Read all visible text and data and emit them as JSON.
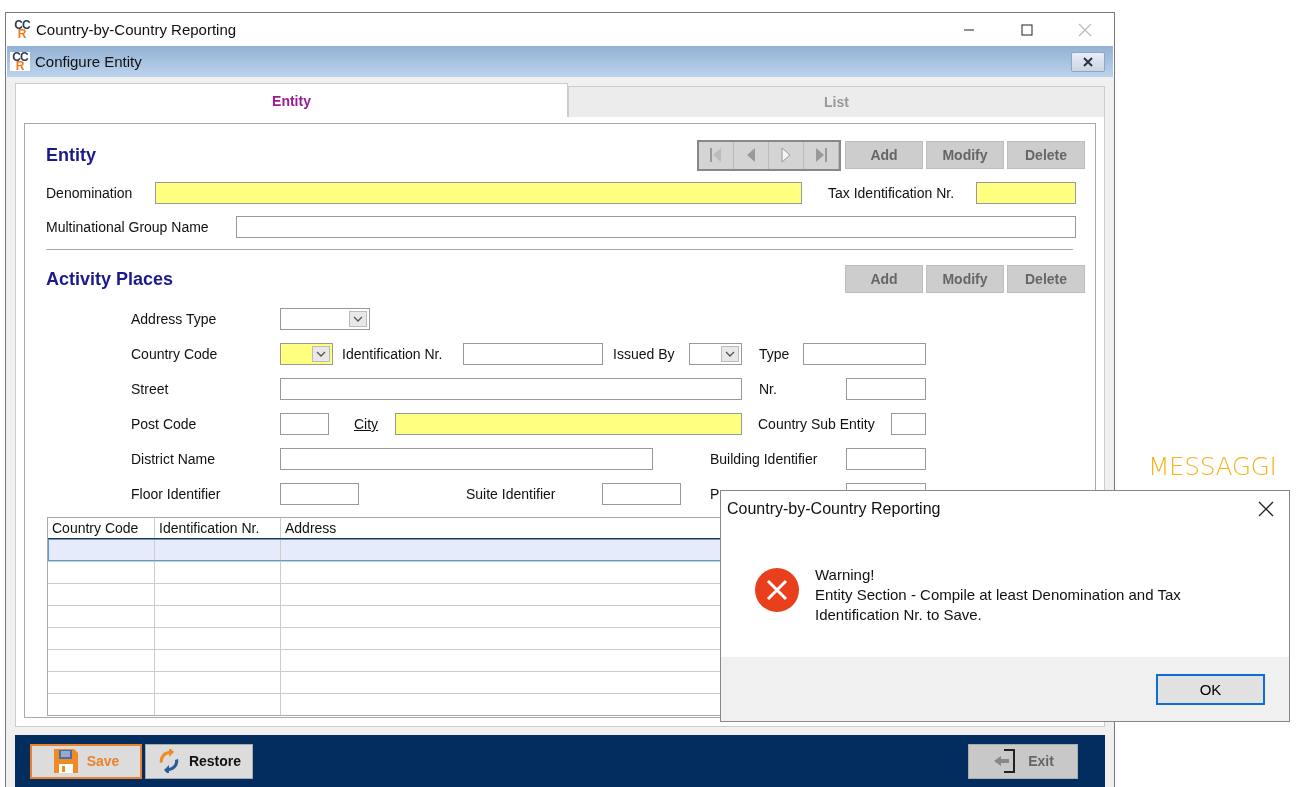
{
  "window": {
    "title": "Country-by-Country Reporting",
    "icon": {
      "top": "CC",
      "bottom": "R"
    },
    "close_disabled": true
  },
  "inner_window": {
    "title": "Configure Entity",
    "icon": {
      "top": "CC",
      "bottom": "R"
    }
  },
  "tabs": [
    {
      "label": "Entity",
      "selected": true
    },
    {
      "label": "List",
      "selected": false
    }
  ],
  "entity": {
    "heading": "Entity",
    "navigator_disabled": true,
    "buttons": [
      {
        "label": "Add",
        "disabled": true
      },
      {
        "label": "Modify",
        "disabled": true
      },
      {
        "label": "Delete",
        "disabled": true
      }
    ],
    "denomination": {
      "label": "Denomination",
      "required": true
    },
    "tax_id": {
      "label": "Tax Identification Nr.",
      "required": true
    },
    "group_name": {
      "label": "Multinational Group Name",
      "required": false
    }
  },
  "activity_places": {
    "heading": "Activity Places",
    "buttons": [
      {
        "label": "Add",
        "disabled": true
      },
      {
        "label": "Modify",
        "disabled": true
      },
      {
        "label": "Delete",
        "disabled": true
      }
    ],
    "fields": [
      {
        "kind": "label",
        "text": "Address Type"
      },
      {
        "kind": "combo",
        "required": false
      },
      {
        "kind": "label",
        "text": "Country Code"
      },
      {
        "kind": "combo",
        "required": true
      },
      {
        "kind": "label",
        "text": "Identification Nr."
      },
      {
        "kind": "field",
        "required": false
      },
      {
        "kind": "label",
        "text": "Issued By"
      },
      {
        "kind": "combo",
        "required": false
      },
      {
        "kind": "label",
        "text": "Type"
      },
      {
        "kind": "field",
        "required": false
      },
      {
        "kind": "label",
        "text": "Street"
      },
      {
        "kind": "field",
        "required": false
      },
      {
        "kind": "label",
        "text": "Nr."
      },
      {
        "kind": "field",
        "required": false
      },
      {
        "kind": "label",
        "text": "Post Code"
      },
      {
        "kind": "field",
        "required": false
      },
      {
        "kind": "link",
        "text": "City"
      },
      {
        "kind": "field",
        "required": true
      },
      {
        "kind": "label",
        "text": "Country Sub Entity"
      },
      {
        "kind": "field",
        "required": false
      },
      {
        "kind": "label",
        "text": "District Name"
      },
      {
        "kind": "field",
        "required": false
      },
      {
        "kind": "label",
        "text": "Building Identifier"
      },
      {
        "kind": "field",
        "required": false
      },
      {
        "kind": "label",
        "text": "Floor Identifier"
      },
      {
        "kind": "field",
        "required": false
      },
      {
        "kind": "label",
        "text": "Suite Identifier"
      },
      {
        "kind": "field",
        "required": false
      },
      {
        "kind": "label",
        "text": "P"
      },
      {
        "kind": "field",
        "required": false
      }
    ]
  },
  "table": {
    "columns": [
      "Country Code",
      "Identification Nr.",
      "Address"
    ],
    "rows": [
      {
        "selected": true
      },
      {
        "selected": false
      },
      {
        "selected": false
      },
      {
        "selected": false
      },
      {
        "selected": false
      },
      {
        "selected": false
      },
      {
        "selected": false
      },
      {
        "selected": false
      }
    ]
  },
  "footer": {
    "buttons": [
      {
        "kind": "save",
        "label": "Save",
        "focused": true,
        "disabled": false
      },
      {
        "kind": "restore",
        "label": "Restore",
        "focused": false,
        "disabled": false
      },
      {
        "kind": "exit",
        "label": "Exit",
        "focused": false,
        "disabled": true
      }
    ]
  },
  "message_box": {
    "title": "Country-by-Country Reporting",
    "heading": "Warning!",
    "message": "Entity Section - Compile at least Denomination and Tax Identification Nr. to Save.",
    "button": "OK"
  },
  "background_text": "MESSAGGI"
}
